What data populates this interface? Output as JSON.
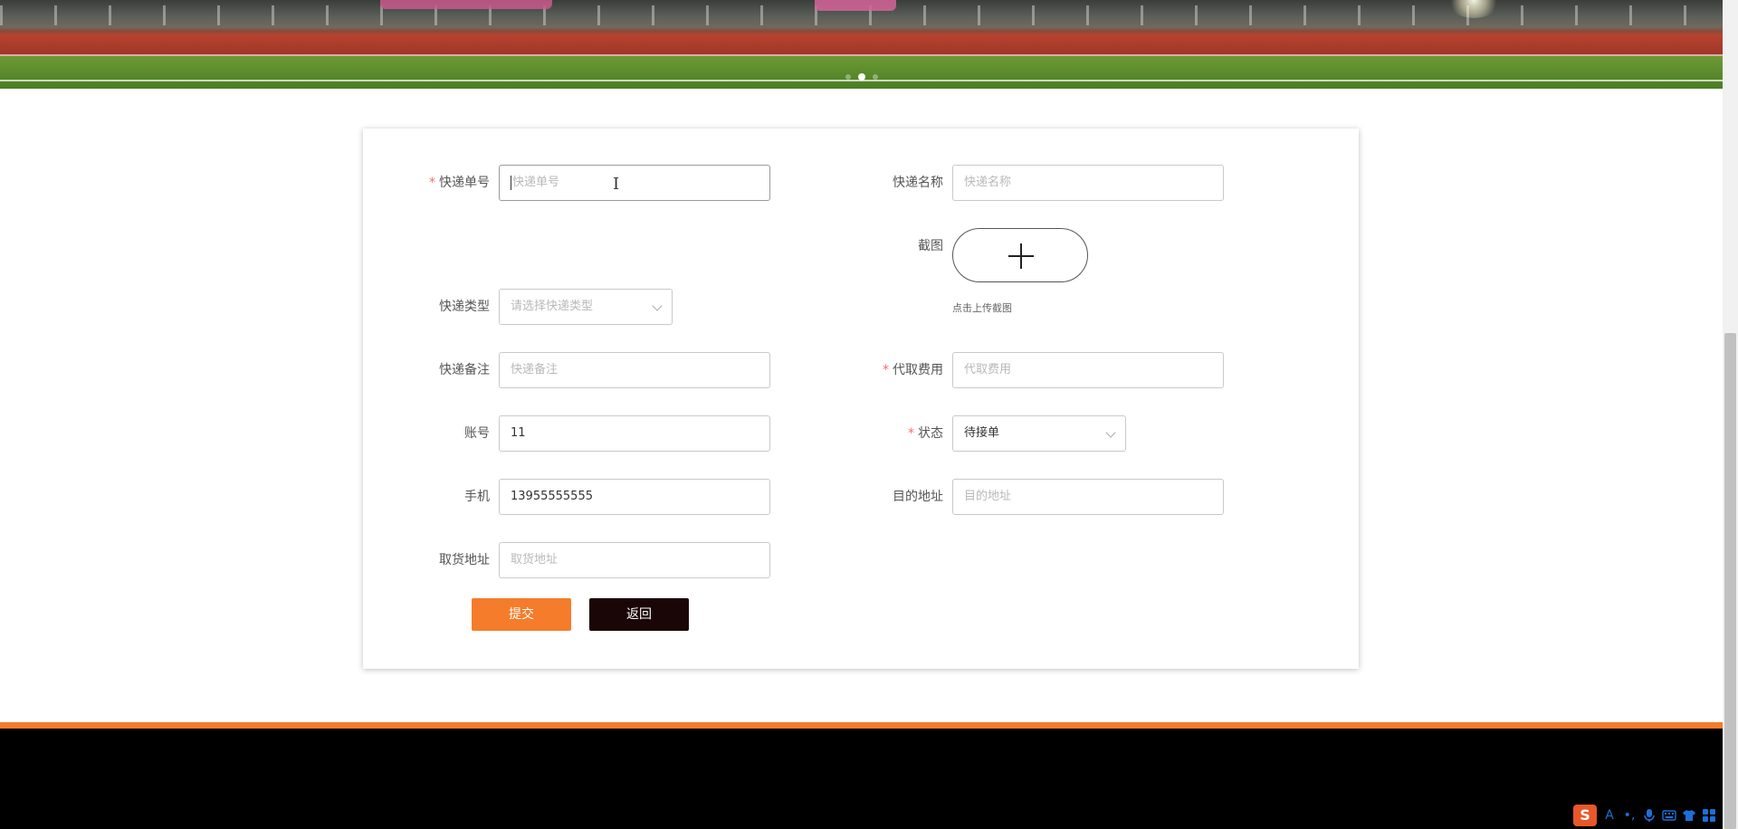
{
  "banner": {
    "carousel_dots": 3,
    "active_dot": 1
  },
  "form": {
    "tracking_no": {
      "label": "快递单号",
      "required": true,
      "placeholder": "快递单号",
      "value": ""
    },
    "courier_name": {
      "label": "快递名称",
      "required": false,
      "placeholder": "快递名称",
      "value": ""
    },
    "screenshot": {
      "label": "截图",
      "hint": "点击上传截图",
      "icon": "plus-icon"
    },
    "courier_type": {
      "label": "快递类型",
      "required": false,
      "placeholder": "请选择快递类型"
    },
    "courier_note": {
      "label": "快递备注",
      "required": false,
      "placeholder": "快递备注",
      "value": ""
    },
    "pickup_fee": {
      "label": "代取费用",
      "required": true,
      "placeholder": "代取费用",
      "value": ""
    },
    "account": {
      "label": "账号",
      "required": false,
      "value": "11"
    },
    "status": {
      "label": "状态",
      "required": true,
      "value": "待接单"
    },
    "phone": {
      "label": "手机",
      "required": false,
      "value": "13955555555"
    },
    "destination": {
      "label": "目的地址",
      "required": false,
      "placeholder": "目的地址",
      "value": ""
    },
    "pickup_address": {
      "label": "取货地址",
      "required": false,
      "placeholder": "取货地址",
      "value": ""
    },
    "required_mark": "*"
  },
  "buttons": {
    "submit": "提交",
    "back": "返回"
  },
  "ime": {
    "logo": "S",
    "items": [
      "A",
      "•,",
      "mic-icon",
      "keyboard-icon",
      "shirt-icon",
      "grid-icon"
    ]
  },
  "colors": {
    "accent": "#f47c2a",
    "back_button": "#1a0606",
    "required": "#f56c6c",
    "footer": "#000000"
  }
}
